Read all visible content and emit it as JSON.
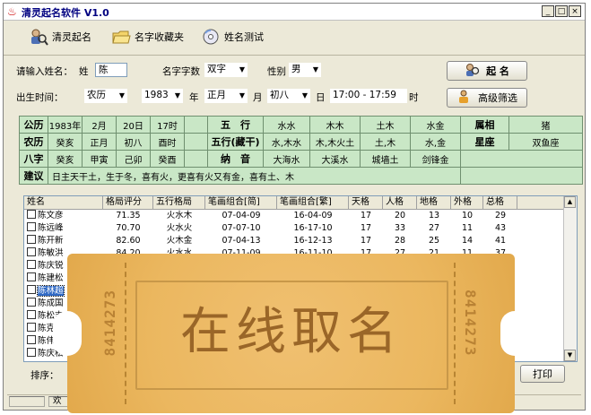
{
  "window": {
    "logo": "♨",
    "title": "清灵起名软件 V1.0",
    "controls": [
      "_",
      "□",
      "×"
    ]
  },
  "toolbar": {
    "items": [
      {
        "label": "清灵起名",
        "icon": "person-magnifier-icon"
      },
      {
        "label": "名字收藏夹",
        "icon": "folder-icon"
      },
      {
        "label": "姓名测试",
        "icon": "disc-icon"
      }
    ]
  },
  "form": {
    "surname_label": "请输入姓名：",
    "surname_prefix": "姓",
    "surname_value": "陈",
    "name_count_label": "名字字数",
    "name_count_value": "双字",
    "gender_label": "性别",
    "gender_value": "男",
    "birth_label": "出生时间：",
    "calendar_value": "农历",
    "year_value": "1983",
    "year_unit": "年",
    "month_value": "正月",
    "month_unit": "月",
    "day_value": "初八",
    "day_unit": "日",
    "hour_value": "17:00 - 17:59",
    "hour_unit": "时",
    "start_button": "起 名",
    "filter_button": "高级筛选"
  },
  "info": {
    "gongli": {
      "label": "公历",
      "values": [
        "1983年",
        "2月",
        "20日",
        "17时"
      ]
    },
    "nongli": {
      "label": "农历",
      "values": [
        "癸亥",
        "正月",
        "初八",
        "酉时"
      ]
    },
    "bazi": {
      "label": "八字",
      "values": [
        "癸亥",
        "甲寅",
        "己卯",
        "癸酉"
      ]
    },
    "wuxing": {
      "label": "五　行",
      "values": [
        "水水",
        "木木",
        "土木",
        "水金"
      ]
    },
    "wuxing_cang": {
      "label": "五行(藏干)",
      "values": [
        "水,木水",
        "木,木火土",
        "土,木",
        "水,金"
      ]
    },
    "nayin": {
      "label": "纳　音",
      "values": [
        "大海水",
        "大溪水",
        "城墙土",
        "剑锋金"
      ]
    },
    "shuxiang": {
      "label": "属相",
      "value": "猪"
    },
    "xingzuo": {
      "label": "星座",
      "value": "双鱼座"
    },
    "advice": {
      "label": "建议",
      "value": "日主天干土，生于冬，喜有火，更喜有火又有金，喜有土、木"
    }
  },
  "list": {
    "columns": [
      "姓名",
      "格局评分",
      "五行格局",
      "笔画组合[简]",
      "笔画组合[繁]",
      "天格",
      "人格",
      "地格",
      "外格",
      "总格"
    ],
    "rows": [
      [
        "陈文彦",
        "71.35",
        "火水木",
        "07-04-09",
        "16-04-09",
        "17",
        "20",
        "13",
        "10",
        "29"
      ],
      [
        "陈远峰",
        "70.70",
        "火水火",
        "07-07-10",
        "16-17-10",
        "17",
        "33",
        "27",
        "11",
        "43"
      ],
      [
        "陈开新",
        "82.60",
        "火木金",
        "07-04-13",
        "16-12-13",
        "17",
        "28",
        "25",
        "14",
        "41"
      ],
      [
        "陈敏洪",
        "84.20",
        "火水水",
        "07-11-09",
        "16-11-10",
        "17",
        "27",
        "21",
        "11",
        "37"
      ],
      [
        "陈庆锐",
        "",
        "",
        "",
        "",
        "",
        "",
        "",
        "",
        ""
      ],
      [
        "陈建松",
        "",
        "",
        "",
        "",
        "",
        "",
        "",
        "",
        ""
      ],
      [
        "陈林超",
        "",
        "",
        "",
        "",
        "",
        "",
        "",
        "",
        ""
      ],
      [
        "陈成国",
        "",
        "",
        "",
        "",
        "",
        "",
        "",
        "",
        ""
      ],
      [
        "陈松吉",
        "",
        "",
        "",
        "",
        "",
        "",
        "",
        "",
        ""
      ],
      [
        "陈克明",
        "",
        "",
        "",
        "",
        "",
        "",
        "",
        "",
        ""
      ],
      [
        "陈伟根",
        "",
        "",
        "",
        "",
        "",
        "",
        "",
        "",
        ""
      ],
      [
        "陈庆松",
        "",
        "",
        "",
        "",
        "",
        "",
        "",
        "",
        ""
      ]
    ]
  },
  "bottom": {
    "sort_label": "排序：",
    "print_button": "打印",
    "status_text": "欢"
  },
  "ticket": {
    "main_text": "在线取名",
    "serial": "8414273"
  }
}
